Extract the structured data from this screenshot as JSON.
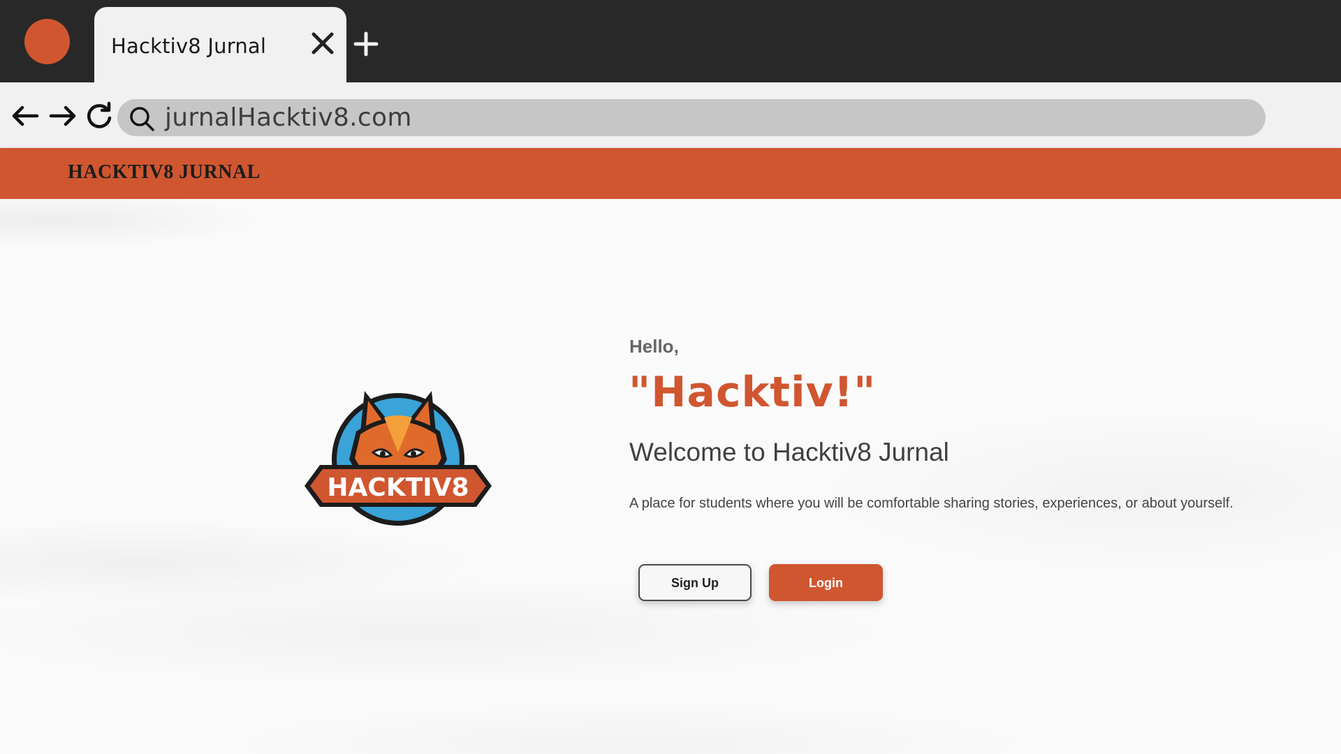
{
  "colors": {
    "accent": "#d05630",
    "chrome_dark": "#282828",
    "chrome_light": "#f1f1f2",
    "url_bg": "#c6c6c6"
  },
  "browser": {
    "tab": {
      "title": "Hacktiv8 Jurnal",
      "close_icon": "close-icon"
    },
    "new_tab_icon": "plus-icon",
    "nav": {
      "back_icon": "arrow-left-icon",
      "forward_icon": "arrow-right-icon",
      "reload_icon": "reload-icon"
    },
    "address": {
      "search_icon": "search-icon",
      "url": "jurnalHacktiv8.com"
    }
  },
  "site": {
    "brand": "HACKTIV8 JURNAL",
    "logo": {
      "icon": "fox-logo",
      "text": "HACKTIV8"
    },
    "hero": {
      "greeting": "Hello,",
      "headline": "\"Hacktiv!\"",
      "welcome": "Welcome to Hacktiv8 Jurnal",
      "description": "A place for students where you will be comfortable sharing stories, experiences, or about yourself."
    },
    "buttons": {
      "signup": "Sign Up",
      "login": "Login"
    }
  }
}
